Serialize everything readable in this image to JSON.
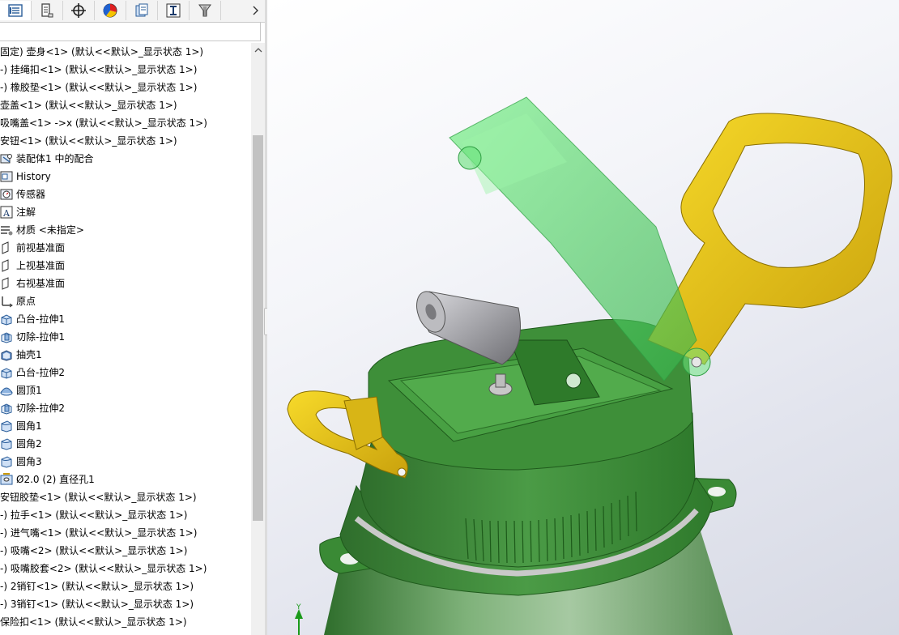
{
  "tabs": [
    {
      "name": "feature-manager-tab",
      "icon": "feature-tree-icon"
    },
    {
      "name": "property-manager-tab",
      "icon": "property-manager-icon"
    },
    {
      "name": "configuration-manager-tab",
      "icon": "configuration-icon"
    },
    {
      "name": "dimxpert-tab",
      "icon": "crosshair-icon"
    },
    {
      "name": "display-manager-tab",
      "icon": "appearance-icon"
    },
    {
      "name": "cam-tab",
      "icon": "cam-icon"
    },
    {
      "name": "simulation-tab",
      "icon": "funnel-icon"
    }
  ],
  "tab_more_icon": "chevron-right-icon",
  "tree": [
    {
      "label": "固定) 壶身<1> (默认<<默认>_显示状态 1>)",
      "icon": "",
      "root": true
    },
    {
      "label": "-) 挂绳扣<1> (默认<<默认>_显示状态 1>)",
      "icon": "",
      "root": true
    },
    {
      "label": "-) 橡胶垫<1> (默认<<默认>_显示状态 1>)",
      "icon": "",
      "root": true
    },
    {
      "label": "壶盖<1> (默认<<默认>_显示状态 1>)",
      "icon": "",
      "root": true
    },
    {
      "label": "吸嘴盖<1> ->x (默认<<默认>_显示状态 1>)",
      "icon": "",
      "root": true
    },
    {
      "label": "安钮<1> (默认<<默认>_显示状态 1>)",
      "icon": "",
      "root": true
    },
    {
      "label": "装配体1 中的配合",
      "icon": "mates-icon",
      "root": false
    },
    {
      "label": "History",
      "icon": "history-icon",
      "root": false
    },
    {
      "label": "传感器",
      "icon": "sensor-icon",
      "root": false
    },
    {
      "label": "注解",
      "icon": "annotation-icon",
      "root": false
    },
    {
      "label": "材质 <未指定>",
      "icon": "material-icon",
      "root": false
    },
    {
      "label": "前视基准面",
      "icon": "plane-icon",
      "root": false
    },
    {
      "label": "上视基准面",
      "icon": "plane-icon",
      "root": false
    },
    {
      "label": "右视基准面",
      "icon": "plane-icon",
      "root": false
    },
    {
      "label": "原点",
      "icon": "origin-icon",
      "root": false
    },
    {
      "label": "凸台-拉伸1",
      "icon": "boss-extrude-icon",
      "root": false
    },
    {
      "label": "切除-拉伸1",
      "icon": "cut-extrude-icon",
      "root": false
    },
    {
      "label": "抽壳1",
      "icon": "shell-icon",
      "root": false
    },
    {
      "label": "凸台-拉伸2",
      "icon": "boss-extrude-icon",
      "root": false
    },
    {
      "label": "圆顶1",
      "icon": "dome-icon",
      "root": false
    },
    {
      "label": "切除-拉伸2",
      "icon": "cut-extrude-icon",
      "root": false
    },
    {
      "label": "圆角1",
      "icon": "fillet-icon",
      "root": false
    },
    {
      "label": "圆角2",
      "icon": "fillet-icon",
      "root": false
    },
    {
      "label": "圆角3",
      "icon": "fillet-icon",
      "root": false
    },
    {
      "label": "Ø2.0 (2) 直径孔1",
      "icon": "hole-icon",
      "root": false
    },
    {
      "label": "安钮胶垫<1> (默认<<默认>_显示状态 1>)",
      "icon": "",
      "root": true
    },
    {
      "label": "-) 拉手<1> (默认<<默认>_显示状态 1>)",
      "icon": "",
      "root": true
    },
    {
      "label": "-) 进气嘴<1> (默认<<默认>_显示状态 1>)",
      "icon": "",
      "root": true
    },
    {
      "label": "-) 吸嘴<2> (默认<<默认>_显示状态 1>)",
      "icon": "",
      "root": true
    },
    {
      "label": "-) 吸嘴胶套<2> (默认<<默认>_显示状态 1>)",
      "icon": "",
      "root": true
    },
    {
      "label": "-) 2销钉<1> (默认<<默认>_显示状态 1>)",
      "icon": "",
      "root": true
    },
    {
      "label": "-) 3销钉<1> (默认<<默认>_显示状态 1>)",
      "icon": "",
      "root": true
    },
    {
      "label": "保险扣<1> (默认<<默认>_显示状态 1>)",
      "icon": "",
      "root": true
    }
  ],
  "viewport": {
    "triad_axis": "Y",
    "colors": {
      "body_green": "#3f8a3a",
      "handle_yellow": "#e8c21a",
      "nozzle_gray": "#a9a9ad",
      "lid_translucent": "#55d96b"
    }
  }
}
